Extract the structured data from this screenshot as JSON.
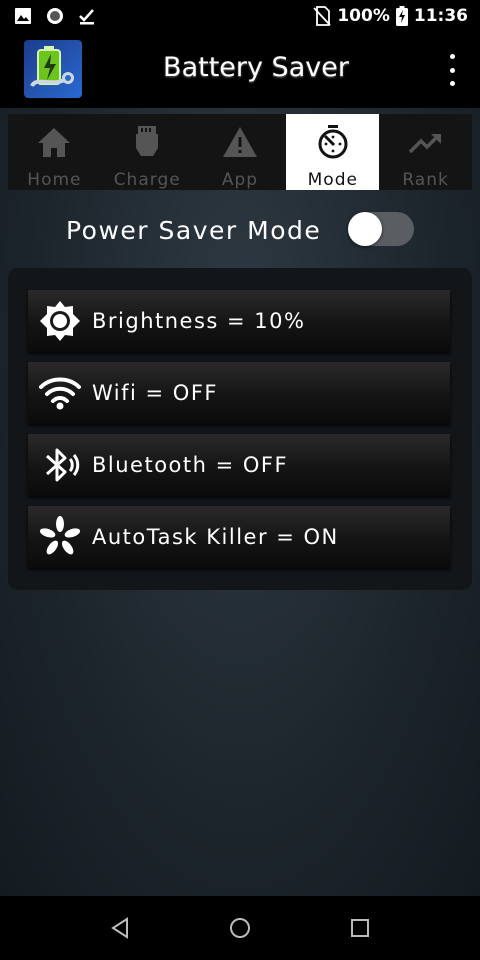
{
  "status_bar": {
    "battery_percent": "100%",
    "time": "11:36"
  },
  "app_bar": {
    "title": "Battery Saver"
  },
  "tabs": [
    {
      "label": "Home",
      "icon": "home-icon",
      "active": false
    },
    {
      "label": "Charge",
      "icon": "charger-plug-icon",
      "active": false
    },
    {
      "label": "App",
      "icon": "warning-icon",
      "active": false
    },
    {
      "label": "Mode",
      "icon": "timer-icon",
      "active": true
    },
    {
      "label": "Rank",
      "icon": "trending-up-icon",
      "active": false
    }
  ],
  "power_saver": {
    "label": "Power Saver Mode",
    "enabled": false
  },
  "settings": [
    {
      "label": "Brightness = 10%",
      "icon": "brightness-icon"
    },
    {
      "label": "Wifi = OFF",
      "icon": "wifi-icon"
    },
    {
      "label": "Bluetooth = OFF",
      "icon": "bluetooth-icon"
    },
    {
      "label": "AutoTask Killer = ON",
      "icon": "task-killer-icon"
    }
  ],
  "colors": {
    "accent_green": "#7ed321",
    "tab_active_bg": "#ffffff",
    "tab_inactive_text": "#555555"
  }
}
